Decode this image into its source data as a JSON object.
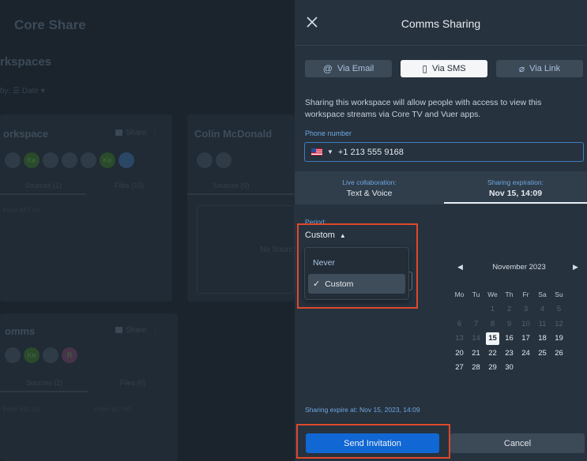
{
  "background": {
    "app_title": "Core Share",
    "workspaces_title": "rkspaces",
    "sort_label": "by:",
    "sort_value": "Date",
    "card1": {
      "title": "orkspace",
      "share": "Share",
      "avatars": [
        "",
        "Ke",
        "",
        "",
        "",
        "Ke",
        ""
      ],
      "tab_sources": "Sources (1)",
      "tab_files": "Files (10)",
      "item": "Form 657-00"
    },
    "card2": {
      "title": "Colin McDonald",
      "tab_sources": "Sources (0)",
      "empty": "No Sourc"
    },
    "card3": {
      "title": "omms",
      "share": "Share",
      "avatars": [
        "",
        "Ke",
        "",
        "R"
      ],
      "tab_sources": "Sources (2)",
      "tab_files": "Files (0)",
      "item1": "Form 657-00",
      "item2": "Form 657-00"
    }
  },
  "panel": {
    "title": "Comms Sharing",
    "tabs": [
      {
        "icon": "@",
        "label": "Via Email",
        "active": false
      },
      {
        "icon": "▯",
        "label": "Via SMS",
        "active": true
      },
      {
        "icon": "⌀",
        "label": "Via Link",
        "active": false
      }
    ],
    "description": "Sharing this workspace will allow people with access to view this workspace streams via Core TV and Vuer apps.",
    "phone_label": "Phone number",
    "phone_value": "+1 213 555 9168",
    "live_label": "Live collaboration:",
    "live_value": "Text & Voice",
    "exp_label": "Sharing expiration:",
    "exp_value": "Nov 15, 14:09",
    "period_label": "Period:",
    "period_value": "Custom",
    "period_options": [
      "Never",
      "Custom"
    ],
    "calendar": {
      "month": "November 2023",
      "weekdays": [
        "Mo",
        "Tu",
        "We",
        "Th",
        "Fr",
        "Sa",
        "Su"
      ],
      "weeks": [
        [
          "",
          "",
          "1",
          "2",
          "3",
          "4",
          "5"
        ],
        [
          "6",
          "7",
          "8",
          "9",
          "10",
          "11",
          "12"
        ],
        [
          "13",
          "14",
          "15",
          "16",
          "17",
          "18",
          "19"
        ],
        [
          "20",
          "21",
          "22",
          "23",
          "24",
          "25",
          "26"
        ],
        [
          "27",
          "28",
          "29",
          "30",
          "",
          "",
          ""
        ]
      ],
      "selected": "15"
    },
    "expire_note": "Sharing expire at: Nov 15, 2023, 14:09",
    "send_label": "Send Invitation",
    "cancel_label": "Cancel"
  },
  "colors": {
    "accent": "#1167d4",
    "highlight": "#e0482b",
    "panel_bg": "#26323e"
  }
}
